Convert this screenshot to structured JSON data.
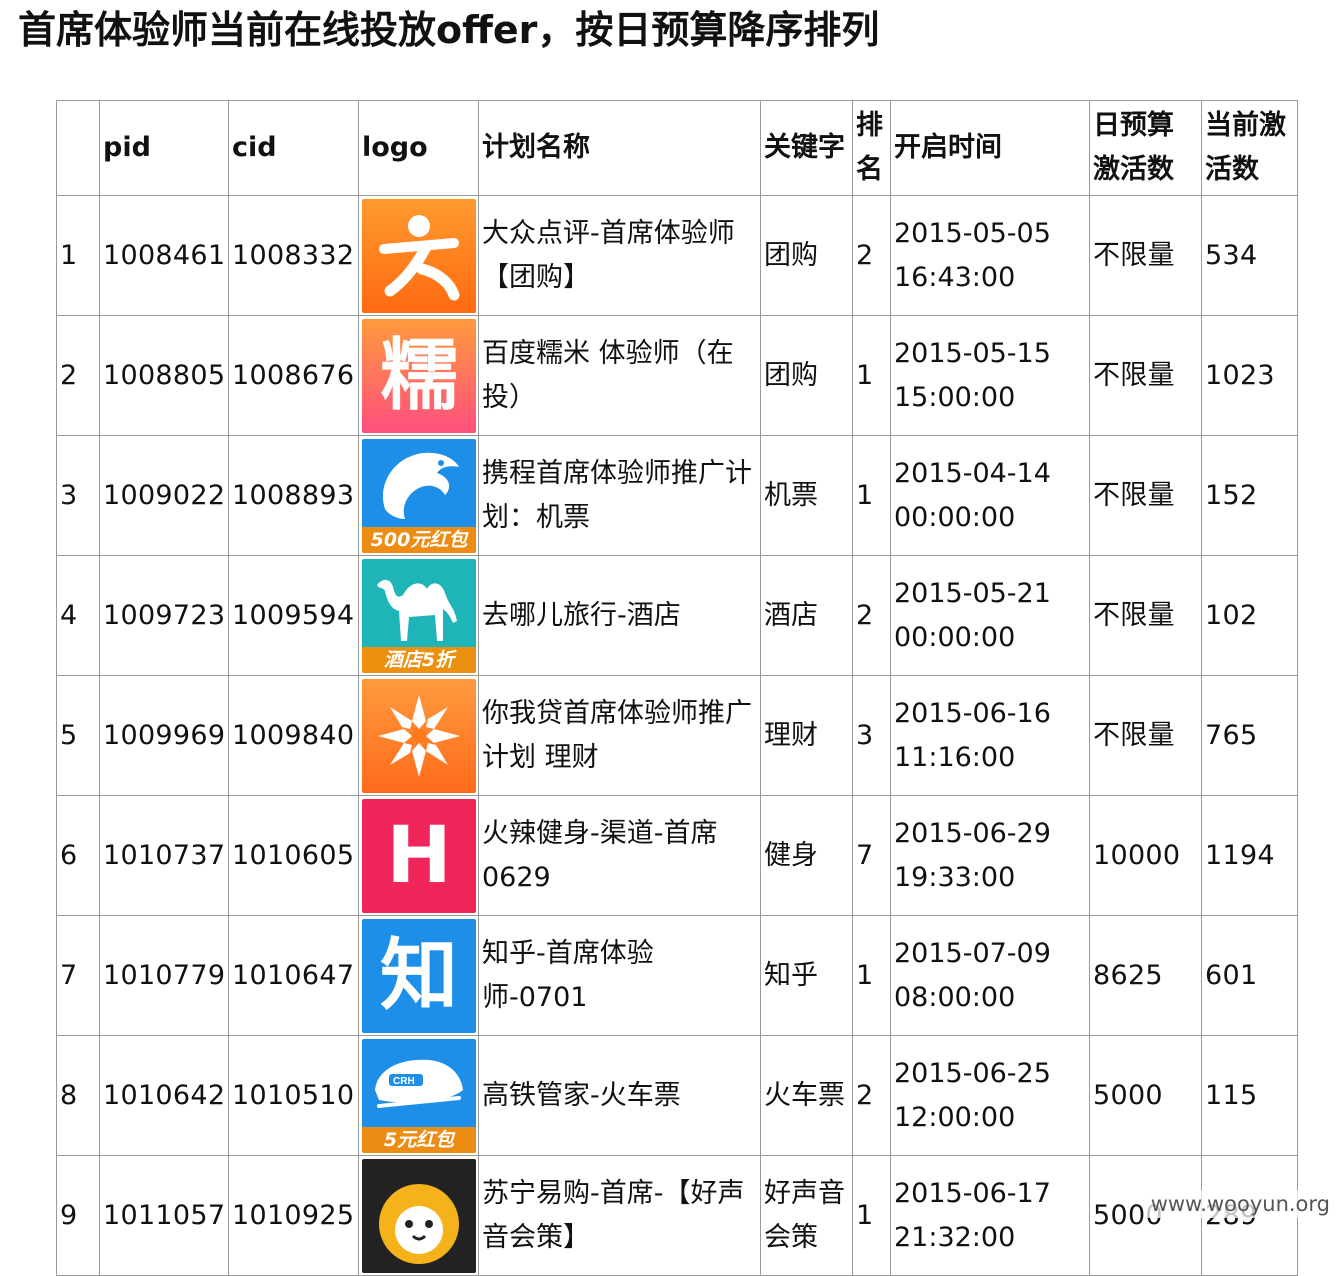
{
  "page": {
    "title": "首席体验师当前在线投放offer，按日预算降序排列",
    "watermark": "www.wooyun.org"
  },
  "table": {
    "headers": {
      "index": "",
      "pid": "pid",
      "cid": "cid",
      "logo": "logo",
      "plan_name": "计划名称",
      "keyword": "关键字",
      "rank": "排名",
      "start_time": "开启时间",
      "daily_budget": "日预算激活数",
      "current_activations": "当前激活数"
    },
    "rows": [
      {
        "index": "1",
        "pid": "1008461",
        "cid": "1008332",
        "logo": {
          "icon": "dianping-icon",
          "color": "#ff7a1a",
          "caption": ""
        },
        "plan_name": "大众点评-首席体验师【团购】",
        "keyword": "团购",
        "rank": "2",
        "start_time": "2015-05-05 16:43:00",
        "daily_budget": "不限量",
        "current_activations": "534"
      },
      {
        "index": "2",
        "pid": "1008805",
        "cid": "1008676",
        "logo": {
          "icon": "nuomi-icon",
          "glyph": "糯",
          "color": "#ff4f7e",
          "caption": ""
        },
        "plan_name": "百度糯米 体验师（在投）",
        "keyword": "团购",
        "rank": "1",
        "start_time": "2015-05-15 15:00:00",
        "daily_budget": "不限量",
        "current_activations": "1023"
      },
      {
        "index": "3",
        "pid": "1009022",
        "cid": "1008893",
        "logo": {
          "icon": "ctrip-dolphin-icon",
          "color": "#1e8fe8",
          "caption": "500元红包"
        },
        "plan_name": "携程首席体验师推广计划：机票",
        "keyword": "机票",
        "rank": "1",
        "start_time": "2015-04-14 00:00:00",
        "daily_budget": "不限量",
        "current_activations": "152"
      },
      {
        "index": "4",
        "pid": "1009723",
        "cid": "1009594",
        "logo": {
          "icon": "qunar-camel-icon",
          "color": "#1fb5b8",
          "caption": "酒店5折"
        },
        "plan_name": "去哪儿旅行-酒店",
        "keyword": "酒店",
        "rank": "2",
        "start_time": "2015-05-21 00:00:00",
        "daily_budget": "不限量",
        "current_activations": "102"
      },
      {
        "index": "5",
        "pid": "1009969",
        "cid": "1009840",
        "logo": {
          "icon": "niwodai-icon",
          "color": "#ff7a1a",
          "caption": ""
        },
        "plan_name": "你我贷首席体验师推广计划 理财",
        "keyword": "理财",
        "rank": "3",
        "start_time": "2015-06-16 11:16:00",
        "daily_budget": "不限量",
        "current_activations": "765"
      },
      {
        "index": "6",
        "pid": "1010737",
        "cid": "1010605",
        "logo": {
          "icon": "huolaxian-h-icon",
          "glyph": "H",
          "color": "#f0255a",
          "caption": ""
        },
        "plan_name": "火辣健身-渠道-首席0629",
        "keyword": "健身",
        "rank": "7",
        "start_time": "2015-06-29 19:33:00",
        "daily_budget": "10000",
        "current_activations": "1194"
      },
      {
        "index": "7",
        "pid": "1010779",
        "cid": "1010647",
        "logo": {
          "icon": "zhihu-icon",
          "glyph": "知",
          "color": "#1e8fe8",
          "caption": ""
        },
        "plan_name": "知乎-首席体验师-0701",
        "keyword": "知乎",
        "rank": "1",
        "start_time": "2015-07-09 08:00:00",
        "daily_budget": "8625",
        "current_activations": "601"
      },
      {
        "index": "8",
        "pid": "1010642",
        "cid": "1010510",
        "logo": {
          "icon": "gaotie-train-icon",
          "color": "#1e8fe8",
          "caption": "5元红包"
        },
        "plan_name": "高铁管家-火车票",
        "keyword": "火车票",
        "rank": "2",
        "start_time": "2015-06-25 12:00:00",
        "daily_budget": "5000",
        "current_activations": "115"
      },
      {
        "index": "9",
        "pid": "1011057",
        "cid": "1010925",
        "logo": {
          "icon": "suning-lion-icon",
          "color": "#222222",
          "caption": ""
        },
        "plan_name": "苏宁易购-首席-【好声音会策】",
        "keyword": "好声音会策",
        "rank": "1",
        "start_time": "2015-06-17 21:32:00",
        "daily_budget": "5000",
        "current_activations": "289"
      }
    ]
  }
}
